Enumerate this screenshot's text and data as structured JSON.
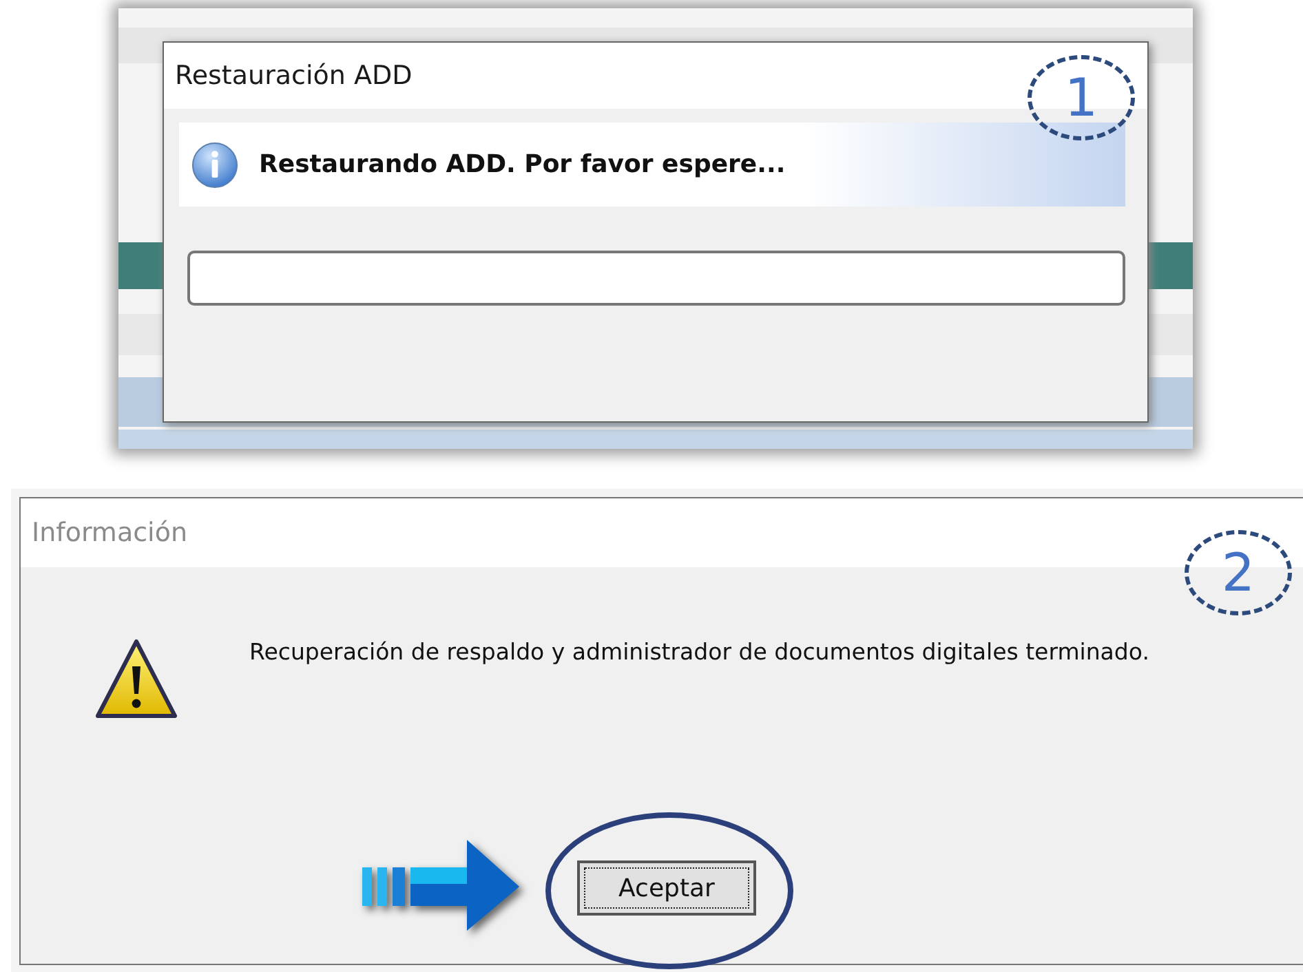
{
  "progress_dialog": {
    "title": "Restauración ADD",
    "message": "Restaurando ADD. Por favor espere...",
    "progress": {
      "level": 0
    },
    "callout": "1"
  },
  "info_dialog": {
    "title": "Información",
    "message": "Recuperación de respaldo y administrador de documentos digitales terminado.",
    "button": "Aceptar",
    "callout": "2"
  }
}
